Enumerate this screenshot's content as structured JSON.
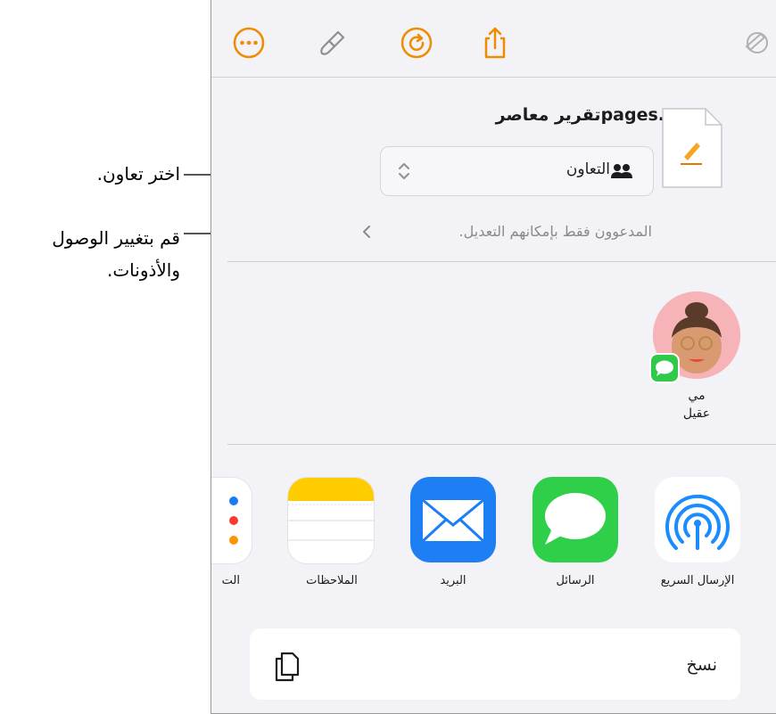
{
  "toolbar": {
    "icons": [
      "more-icon",
      "format-brush-icon",
      "undo-icon",
      "share-icon",
      "collaborate-icon"
    ],
    "accent": "#f08c00"
  },
  "share_sheet": {
    "document_title": ".pagesتقرير معاصر",
    "document_icon": "pages-document-icon",
    "mode_label": "التعاون",
    "access_text": "المدعوون فقط بإمكانهم التعديل.",
    "contact": {
      "line1": "مي",
      "line2": "عقيل"
    },
    "apps": [
      {
        "label": "الإرسال السريع",
        "icon": "airdrop-icon"
      },
      {
        "label": "الرسائل",
        "icon": "messages-icon"
      },
      {
        "label": "البريد",
        "icon": "mail-icon"
      },
      {
        "label": "الملاحظات",
        "icon": "notes-icon"
      },
      {
        "label": "الت",
        "icon": "reminders-icon"
      }
    ],
    "copy_label": "نسخ"
  },
  "annotations": {
    "choose_collab": "اختر تعاون.",
    "change_access_1": "قم بتغيير الوصول",
    "change_access_2": "والأذونات."
  }
}
